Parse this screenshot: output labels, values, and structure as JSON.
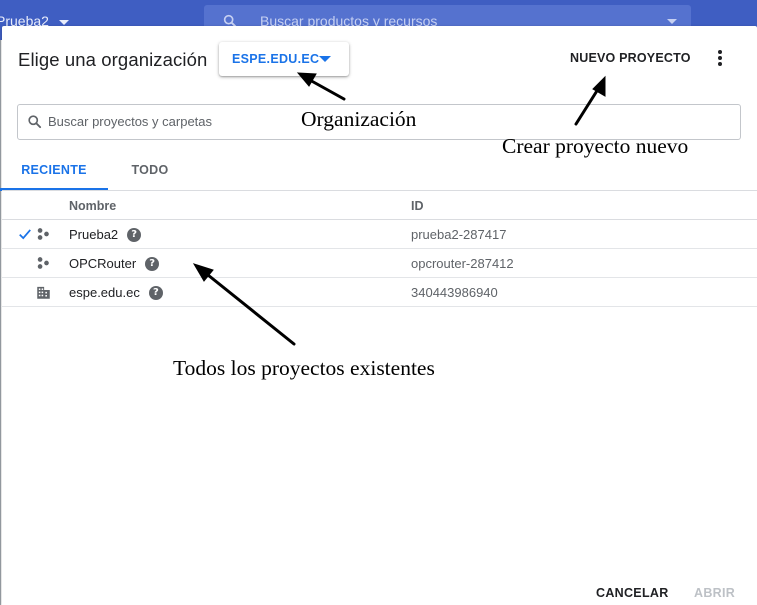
{
  "topbar": {
    "project_name": "Prueba2",
    "search_placeholder": "Buscar productos y recursos",
    "color": "#3f5ec2"
  },
  "dialog": {
    "title": "Elige una organización",
    "organization_select": {
      "value": "ESPE.EDU.EC",
      "icon": "caret-down-icon"
    },
    "new_project_label": "NUEVO PROYECTO",
    "more_icon": "more-vert-icon",
    "search": {
      "placeholder": "Buscar proyectos y carpetas",
      "value": ""
    },
    "tabs": [
      {
        "label": "RECIENTE",
        "active": true
      },
      {
        "label": "TODO",
        "active": false
      }
    ],
    "table": {
      "columns": [
        "Nombre",
        "ID"
      ],
      "rows": [
        {
          "selected": true,
          "type": "project",
          "icon": "project-icon",
          "name": "Prueba2",
          "id": "prueba2-287417"
        },
        {
          "selected": false,
          "type": "project",
          "icon": "project-icon",
          "name": "OPCRouter",
          "id": "opcrouter-287412"
        },
        {
          "selected": false,
          "type": "organization",
          "icon": "building-icon",
          "name": "espe.edu.ec",
          "id": "340443986940"
        }
      ]
    },
    "footer": {
      "cancel_label": "CANCELAR",
      "open_label": "ABRIR"
    }
  },
  "annotations": {
    "organization": "Organización",
    "new_project": "Crear proyecto nuevo",
    "all_projects": "Todos los proyectos existentes"
  },
  "colors": {
    "accent": "#1a73e8",
    "disabled": "#bdc1c6",
    "topbar": "#3f5ec2"
  }
}
